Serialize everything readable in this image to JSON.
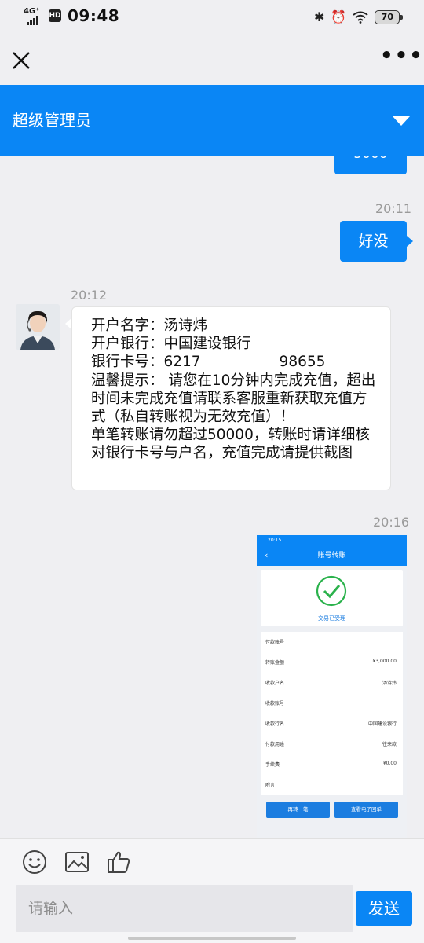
{
  "status_bar": {
    "network": "4G⁺",
    "hd": "HD",
    "time": "09:48",
    "battery": "70"
  },
  "header": {
    "title": "超级管理员"
  },
  "messages": {
    "partial_prev_text": "5000",
    "time1": "20:11",
    "msg1": "好没",
    "time2": "20:12",
    "agent_lines": [
      "开户名字：汤诗炜",
      "开户银行：中国建设银行",
      "银行卡号：6217                 98655",
      "温馨提示： 请您在10分钟内完成充值，超出时间未完成充值请联系客服重新获取充值方式（私自转账视为无效充值）！",
      "单笔转账请勿超过50000，转账时请详细核对银行卡号与户名，充值完成请提供截图"
    ],
    "time3": "20:16"
  },
  "screenshot": {
    "status_time": "20:15",
    "title": "账号转账",
    "success": "交易已受理",
    "rows": [
      {
        "label": "付款账号",
        "value": ""
      },
      {
        "label": "转账金额",
        "value": "¥3,000.00"
      },
      {
        "label": "收款户名",
        "value": "汤诗炜"
      },
      {
        "label": "收款账号",
        "value": ""
      },
      {
        "label": "收款行名",
        "value": "中国建设银行"
      },
      {
        "label": "付款用途",
        "value": "往来款"
      },
      {
        "label": "手续费",
        "value": "¥0.00"
      },
      {
        "label": "附言",
        "value": ""
      }
    ],
    "btn_again": "再转一笔",
    "btn_receipt": "查看电子回单"
  },
  "input": {
    "placeholder": "请输入",
    "send": "发送"
  },
  "colors": {
    "accent": "#0a86f5",
    "background": "#efeff2",
    "success_green": "#2bb24c"
  }
}
